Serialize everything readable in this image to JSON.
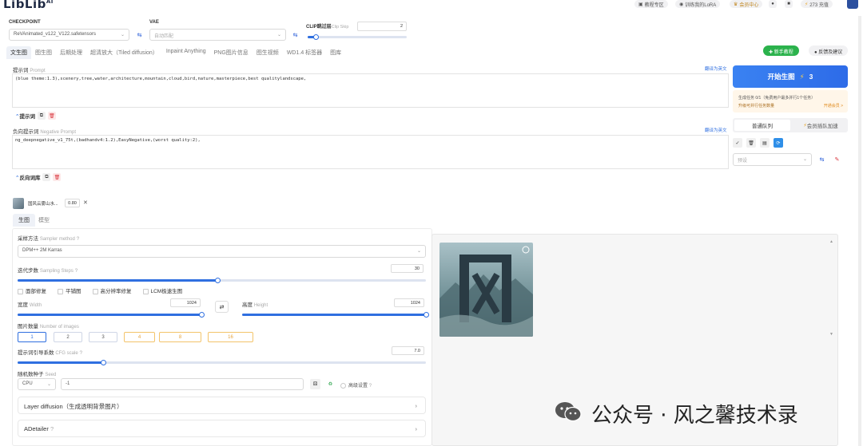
{
  "header": {
    "logo": "LibLib",
    "logo_sup": "AI",
    "buttons": [
      {
        "label": "教程专区",
        "icon": "book-icon"
      },
      {
        "label": "训练我的LoRA",
        "icon": "robot-icon"
      },
      {
        "label": "会员中心",
        "icon": "crown-icon"
      }
    ],
    "credits": "273 充值"
  },
  "model": {
    "checkpoint_label": "CHECKPOINT",
    "checkpoint_value": "ReVAnimated_v122_V122.safetensors",
    "vae_label": "VAE",
    "vae_value": "自动匹配",
    "clip_label": "CLIP跳过层",
    "clip_en": "Clip Skip",
    "clip_value": "2",
    "clip_fraction": 0.08
  },
  "tabs": [
    "文生图",
    "图生图",
    "后期处理",
    "超清放大（Tiled diffusion）",
    "Inpaint Anything",
    "PNG图片信息",
    "图生视频",
    "WD1.4 标签器",
    "图库"
  ],
  "active_tab": 0,
  "top_right": {
    "tutorial_btn": "新手教程",
    "feedback_btn": "反馈及建议"
  },
  "prompt": {
    "label": "提示词",
    "label_en": "Prompt",
    "translate_link": "翻译为英文",
    "value": "(blue theme:1.3),scenery,tree,water,architecture,mountain,cloud,bird,nature,masterpiece,best qualitylandscape,",
    "lib_btn": "提示词"
  },
  "negative": {
    "label": "负向提示词",
    "label_en": "Negative Prompt",
    "translate_link": "翻译为英文",
    "value": "ng_deepnegative_v1_75t,(badhandv4:1.2),EasyNegative,(worst quality:2),",
    "lib_btn": "反向词库"
  },
  "lora_chip": {
    "name": "国风云雾山水...",
    "weight": "0.80"
  },
  "subtabs": [
    "生图",
    "模型"
  ],
  "sampler": {
    "label": "采样方法",
    "label_en": "Sampler method",
    "value": "DPM++ 2M Karras"
  },
  "steps": {
    "label": "迭代步数",
    "label_en": "Sampling Steps",
    "value": "30",
    "fraction": 0.49
  },
  "checkboxes": [
    "面部修复",
    "平铺图",
    "高分辨率修复",
    "LCM极速生图"
  ],
  "width": {
    "label": "宽度",
    "label_en": "Width",
    "value": "1024",
    "fraction": 1.0
  },
  "height": {
    "label": "高度",
    "label_en": "Height",
    "value": "1024",
    "fraction": 1.0
  },
  "batch": {
    "label": "图片数量",
    "label_en": "Number of images",
    "options": [
      "1",
      "2",
      "3",
      "4",
      "8",
      "16"
    ],
    "selected": 0
  },
  "cfg": {
    "label": "提示词引导系数",
    "label_en": "CFG scale",
    "value": "7.0",
    "fraction": 0.21
  },
  "seed": {
    "label": "随机数种子",
    "label_en": "Seed",
    "device": "CPU",
    "value": "-1",
    "advanced": "高级设置"
  },
  "collapses": [
    "Layer diffusion（生成透明背景图片）",
    "ADetailer"
  ],
  "generate": {
    "label": "开始生图",
    "cost": "3",
    "task_line": "生成任务 0/1（免费用户最多并行1个任务）",
    "upgrade_line": "升级可并行任务数量",
    "upgrade_link": "开通会员 >"
  },
  "queue": {
    "normal": "普通队列",
    "vip": "会员插队加速"
  },
  "preset": {
    "placeholder": "预设"
  },
  "watermark": {
    "text": "公众号 · 风之馨技术录"
  }
}
